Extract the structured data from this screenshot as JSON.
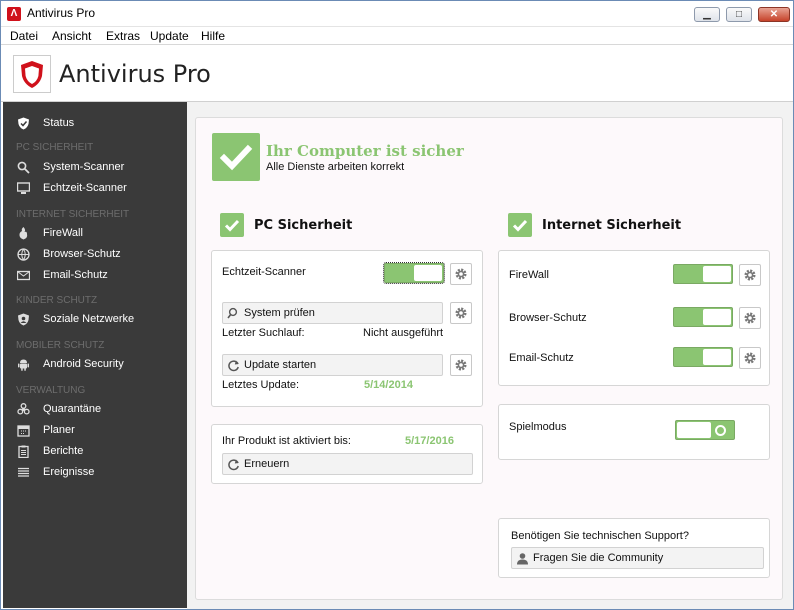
{
  "window": {
    "title": "Antivirus Pro",
    "minimize_label": "▁",
    "maximize_label": "□",
    "close_label": "✕"
  },
  "menu": [
    "Datei",
    "Ansicht",
    "Extras",
    "Update",
    "Hilfe"
  ],
  "header": {
    "title": "Antivirus Pro"
  },
  "sidebar": {
    "status": "Status",
    "categories": {
      "pc": "PC SICHERHEIT",
      "internet": "INTERNET SICHERHEIT",
      "kinder": "KINDER SCHUTZ",
      "mobiler": "MOBILER SCHUTZ",
      "verwaltung": "VERWALTUNG"
    },
    "items": {
      "system_scanner": "System-Scanner",
      "echtzeit_scanner": "Echtzeit-Scanner",
      "firewall": "FireWall",
      "browser_schutz": "Browser-Schutz",
      "email_schutz": "Email-Schutz",
      "soziale_netzwerke": "Soziale Netzwerke",
      "android_security": "Android Security",
      "quarantaene": "Quarantäne",
      "planer": "Planer",
      "berichte": "Berichte",
      "ereignisse": "Ereignisse"
    }
  },
  "status": {
    "title": "Ihr Computer ist sicher",
    "subtitle": "Alle Dienste arbeiten korrekt"
  },
  "pc_section": {
    "title": "PC Sicherheit",
    "realtime_label": "Echtzeit-Scanner",
    "realtime_on": true,
    "scan_button": "System prüfen",
    "last_scan_label": "Letzter Suchlauf:",
    "last_scan_value": "Nicht ausgeführt",
    "update_button": "Update starten",
    "last_update_label": "Letztes Update:",
    "last_update_value": "5/14/2014",
    "activated_label": "Ihr Produkt ist aktiviert bis:",
    "activated_value": "5/17/2016",
    "renew_button": "Erneuern"
  },
  "internet_section": {
    "title": "Internet Sicherheit",
    "firewall_label": "FireWall",
    "firewall_on": true,
    "browser_label": "Browser-Schutz",
    "browser_on": true,
    "email_label": "Email-Schutz",
    "email_on": true,
    "gamemode_label": "Spielmodus",
    "gamemode_on": false
  },
  "support": {
    "question": "Benötigen Sie technischen Support?",
    "community_button": "Fragen Sie die Community"
  },
  "colors": {
    "accent_green": "#8bc572",
    "sidebar_bg": "#3a3a3a",
    "brand_red": "#d0111b"
  }
}
